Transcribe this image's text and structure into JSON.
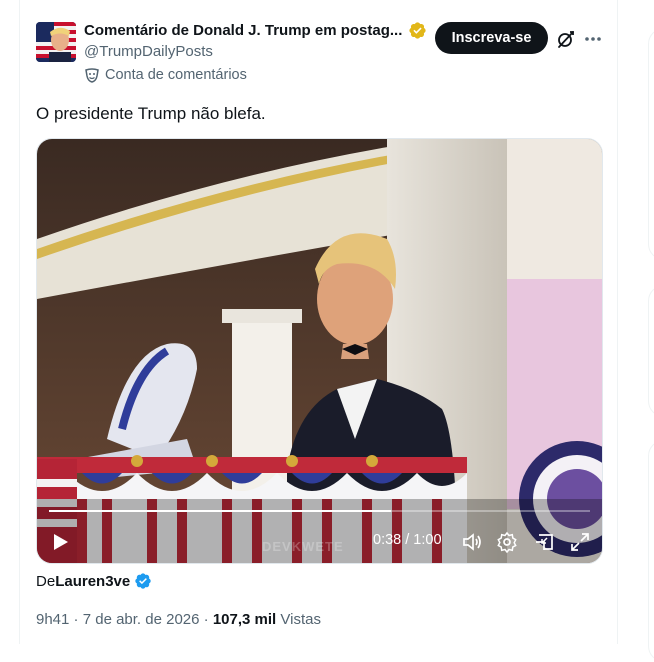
{
  "author": {
    "display_name": "Comentário de Donald J. Trump em postag...",
    "handle": "@TrumpDailyPosts",
    "account_type": "Conta de comentários"
  },
  "actions": {
    "subscribe_label": "Inscreva-se",
    "grok_icon": "grok-icon",
    "more_icon": "more-icon"
  },
  "tweet": {
    "text": "O presidente Trump não blefa."
  },
  "video": {
    "elapsed_fraction": 0.633,
    "time_display": "0:38 / 1:00",
    "watermark": "DEVKWETE"
  },
  "attribution": {
    "prefix": "De",
    "user": "Lauren3ve"
  },
  "meta": {
    "time": "9h41",
    "sep1": " · ",
    "date": "7 de abr. de 2026",
    "sep2": " · ",
    "views": "107,3 mil",
    "views_label": " Vistas"
  },
  "colors": {
    "accent_blue": "#1d9bf0",
    "gold_badge": "#e2b719",
    "text_primary": "#0f1419",
    "text_secondary": "#536471"
  }
}
